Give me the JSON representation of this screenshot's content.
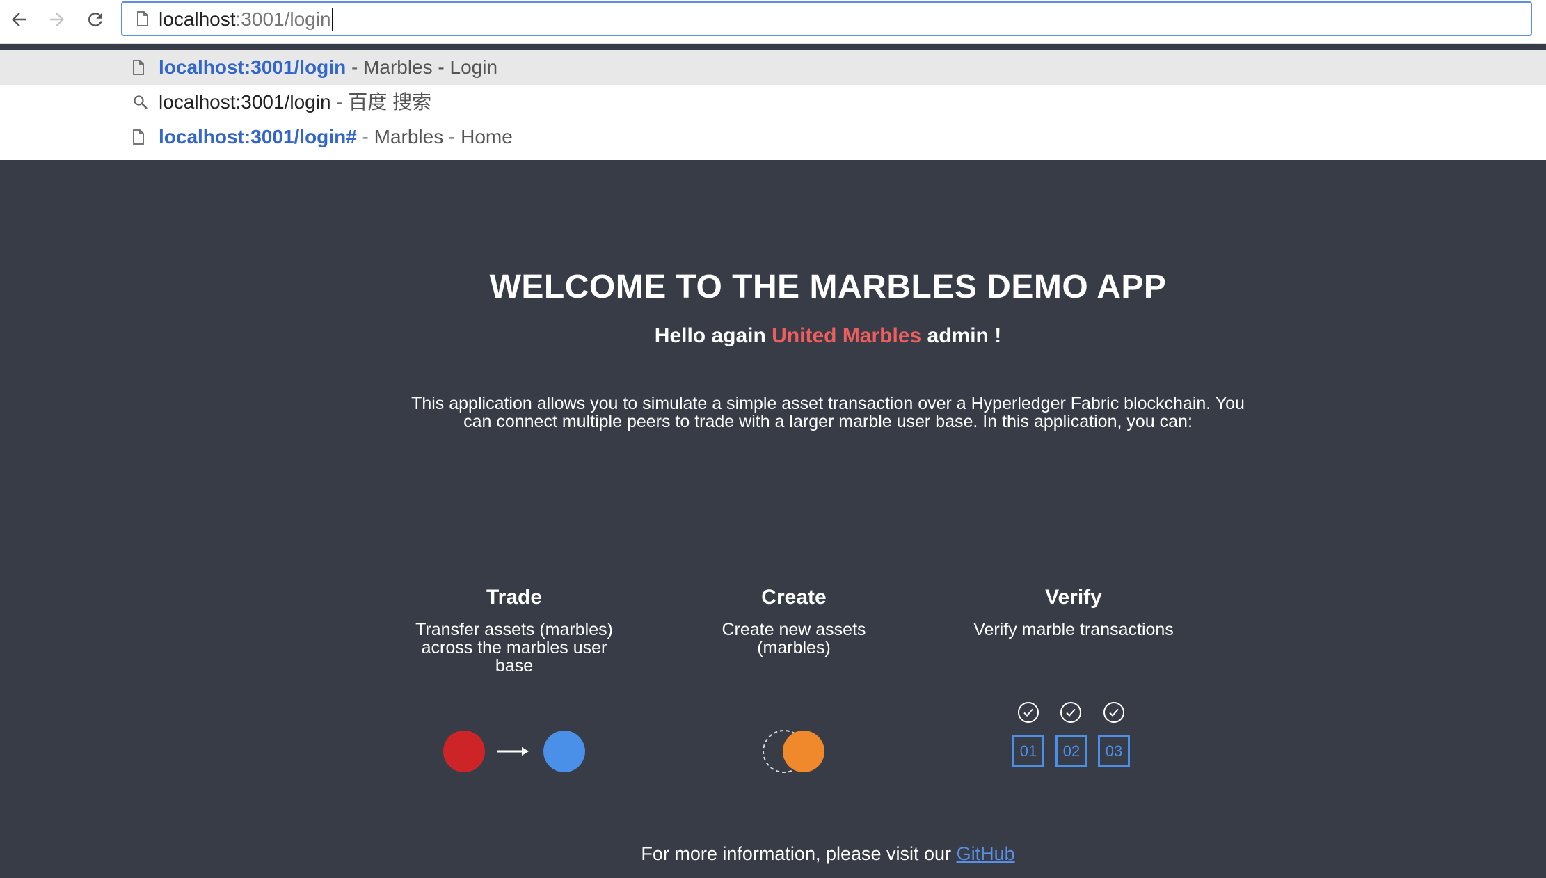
{
  "browser": {
    "omnibox": {
      "host": "localhost",
      "path": ":3001/login"
    },
    "suggestions": [
      {
        "icon": "page-icon",
        "url": "localhost:3001/login",
        "url_style": "bold",
        "separator": " - ",
        "title": "Marbles - Login"
      },
      {
        "icon": "search-icon",
        "url": "localhost:3001/login",
        "url_style": "plain",
        "separator": " - ",
        "title": "百度 搜索"
      },
      {
        "icon": "page-icon",
        "url": "localhost:3001/login#",
        "url_style": "bold",
        "separator": " - ",
        "title": "Marbles - Home"
      }
    ]
  },
  "page": {
    "title": "WELCOME TO THE MARBLES DEMO APP",
    "greeting": {
      "prefix": "Hello again ",
      "company": "United Marbles",
      "suffix": " admin !"
    },
    "description": "This application allows you to simulate a simple asset transaction over a Hyperledger Fabric blockchain. You can connect multiple peers to trade with a larger marble user base. In this application, you can:",
    "features": [
      {
        "title": "Trade",
        "description": "Transfer assets (marbles) across the marbles user base"
      },
      {
        "title": "Create",
        "description": "Create new assets (marbles)"
      },
      {
        "title": "Verify",
        "description": "Verify marble transactions"
      }
    ],
    "verify_blocks": [
      "01",
      "02",
      "03"
    ],
    "footer": {
      "text": "For more information, please visit our ",
      "link_label": "GitHub"
    }
  },
  "colors": {
    "background": "#373c47",
    "accent_red": "#ef5e5e",
    "marble_red": "#cc2427",
    "marble_blue": "#4a8fe8",
    "marble_orange": "#f0882c",
    "link_blue": "#5b8fe4"
  }
}
